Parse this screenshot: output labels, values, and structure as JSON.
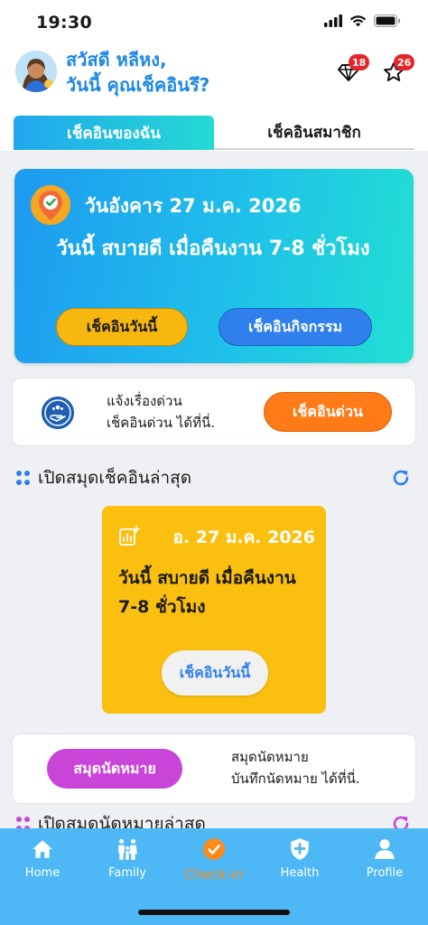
{
  "status_bar": {
    "time": "19:30"
  },
  "header": {
    "greeting_line1": "สวัสดี หลีหง,",
    "greeting_line2": "วันนี้ คุณเช็คอินรึ?",
    "gem_count": "18",
    "star_count": "26"
  },
  "tabs": {
    "my_checkin": "เช็คอินของฉัน",
    "member_checkin": "เช็คอินสมาชิก"
  },
  "today_card": {
    "date": "วันอังคาร 27 ม.ค. 2026",
    "status": "วันนี้ สบายดี เมื่อคืนงาน 7-8 ชั่วโมง",
    "checkin_today_label": "เช็คอินวันนี้",
    "checkin_activity_label": "เช็คอินกิจกรรม"
  },
  "urgent_card": {
    "line1": "แจ้งเรื่องด่วน",
    "line2": "เช็คอินด่วน ได้ที่นี่.",
    "button_label": "เช็คอินด่วน"
  },
  "latest_section": {
    "title": "เปิดสมุดเช็คอินล่าสุด",
    "date": "อ. 27 ม.ค. 2026",
    "status": "วันนี้ สบายดี เมื่อคืนงาน 7-8 ชั่วโมง",
    "button_label": "เช็คอินวันนี้"
  },
  "appointment_card": {
    "button_label": "สมุดนัดหมาย",
    "line1": "สมุดนัดหมาย",
    "line2": "บันทึกนัดหมาย ได้ที่นี่."
  },
  "appointment_section": {
    "title": "เปิดสมุดนัดหมายล่าสุด"
  },
  "bottom_nav": {
    "home": "Home",
    "family": "Family",
    "checkin": "Check-in",
    "health": "Health",
    "profile": "Profile"
  },
  "colors": {
    "primary_blue": "#1e88e5",
    "nav_bg": "#4db8f5",
    "checkin_orange": "#f7b70f",
    "urgent_orange": "#ff7b17",
    "appt_purple": "#c945d8"
  }
}
